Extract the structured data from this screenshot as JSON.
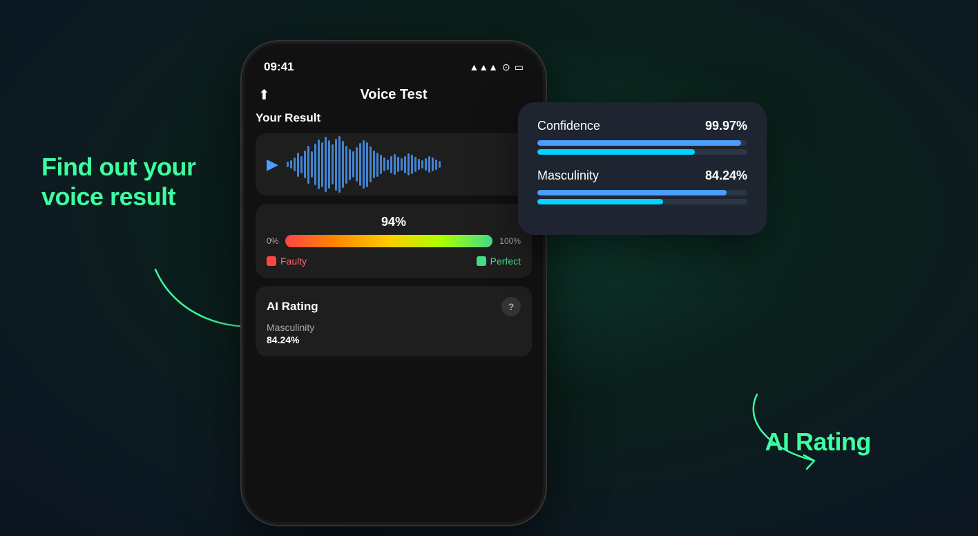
{
  "tagline": {
    "line1": "Find out your",
    "line2": "voice result"
  },
  "ai_rating_label": "AI Rating",
  "phone": {
    "status_bar": {
      "time": "09:41",
      "signal": "▲▲▲",
      "wifi": "WiFi",
      "battery": "Battery"
    },
    "header": {
      "title": "Voice Test",
      "share_icon": "↑"
    },
    "your_result_label": "Your Result",
    "score": {
      "percent": "94%",
      "label_0": "0%",
      "label_100": "100%",
      "legend_faulty": "Faulty",
      "legend_perfect": "Perfect"
    },
    "ai_rating": {
      "title": "AI Rating",
      "help_icon": "?",
      "sub_label": "Masculinity",
      "sub_value": "84.24%"
    }
  },
  "info_card": {
    "confidence_label": "Confidence",
    "confidence_value": "99.97%",
    "confidence_bar1_width": "97%",
    "confidence_bar2_width": "75%",
    "masculinity_label": "Masculinity",
    "masculinity_value": "84.24%",
    "masculinity_bar1_width": "90%",
    "masculinity_bar2_width": "60%"
  },
  "waveform_bars": [
    8,
    12,
    20,
    35,
    25,
    40,
    55,
    38,
    60,
    72,
    65,
    80,
    70,
    58,
    75,
    82,
    68,
    55,
    45,
    38,
    50,
    62,
    70,
    65,
    52,
    40,
    35,
    28,
    20,
    15,
    25,
    30,
    22,
    18,
    25,
    32,
    28,
    22,
    16,
    12,
    18,
    24,
    20,
    15,
    10
  ]
}
